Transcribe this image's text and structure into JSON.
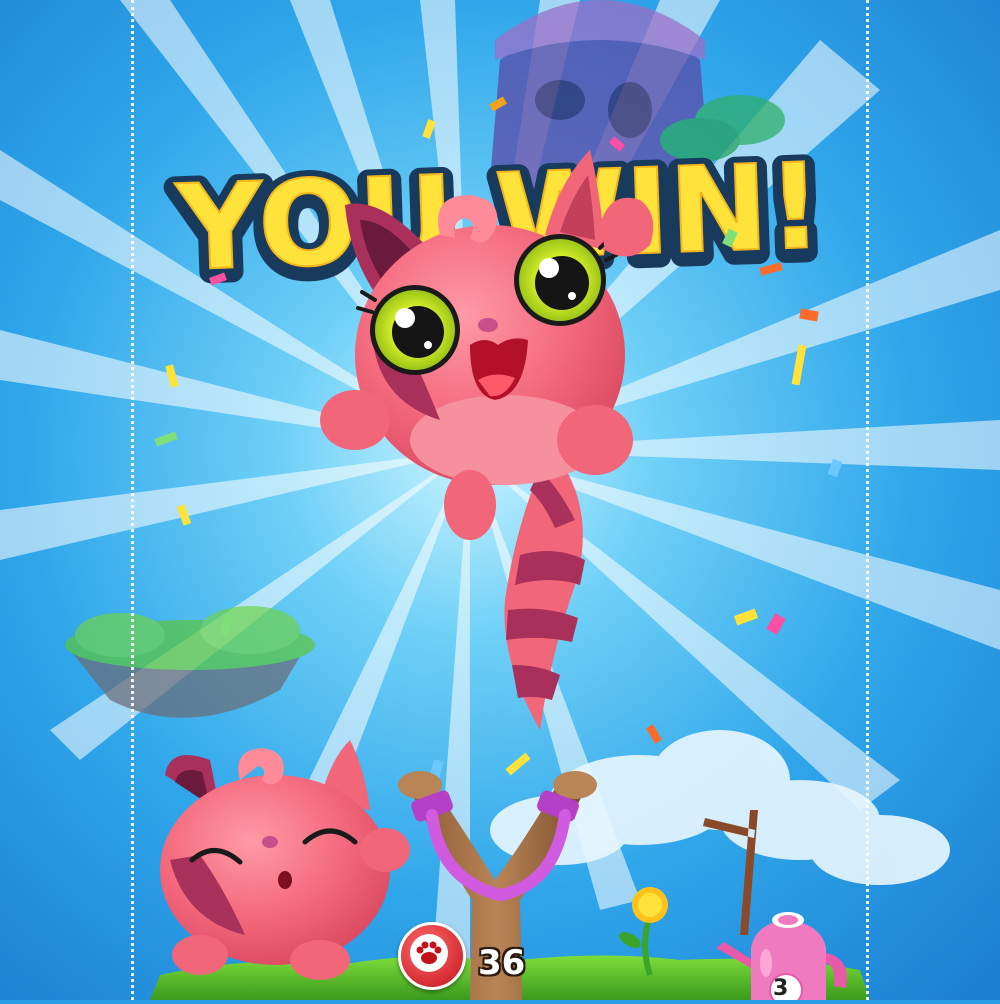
{
  "banner": {
    "text": "YOU WIN!"
  },
  "hud": {
    "shots_remaining": "36",
    "powerup_count": "3",
    "paw_icon": "paw-icon",
    "watering_can_icon": "watering-can-icon"
  },
  "colors": {
    "sky_top": "#1f86d8",
    "sky_glow": "#c9f3ff",
    "banner_fill": "#ffe23a",
    "banner_outline": "#183a5c",
    "cat_pink": "#f2667a",
    "cat_dark": "#a8305a",
    "grass": "#4fbf2d"
  }
}
